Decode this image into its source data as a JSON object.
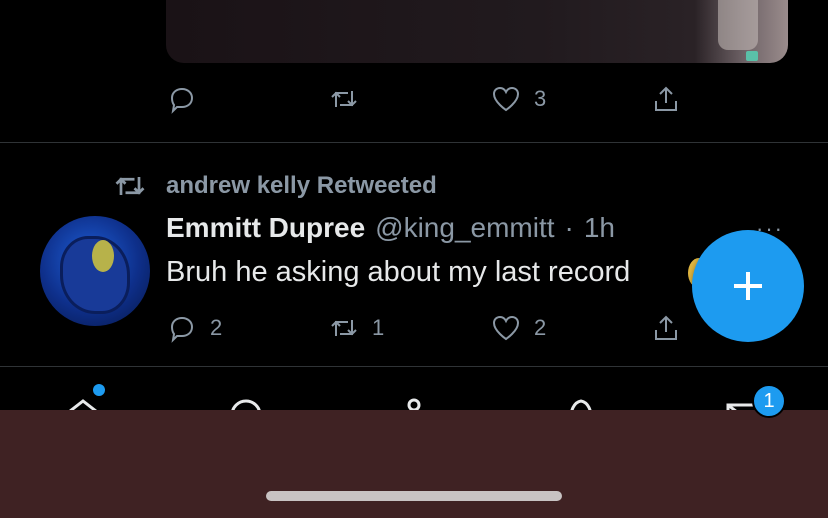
{
  "previous_tweet": {
    "actions": {
      "reply_count": "",
      "retweet_count": "",
      "like_count": "3"
    }
  },
  "retweet_context": {
    "text": "andrew kelly Retweeted"
  },
  "tweet": {
    "display_name": "Emmitt Dupree",
    "handle": "@king_emmitt",
    "separator": "·",
    "time": "1h",
    "body": "Bruh he asking about my last record",
    "more": "···",
    "actions": {
      "reply_count": "2",
      "retweet_count": "1",
      "like_count": "2"
    }
  },
  "fab": {
    "icon": "plus-icon"
  },
  "tabbar": {
    "items": [
      "home-icon",
      "search-icon",
      "spaces-icon",
      "notifications-icon",
      "messages-icon"
    ],
    "messages_badge": "1"
  },
  "colors": {
    "accent": "#1d9bf0",
    "system_area": "#3f2223"
  }
}
